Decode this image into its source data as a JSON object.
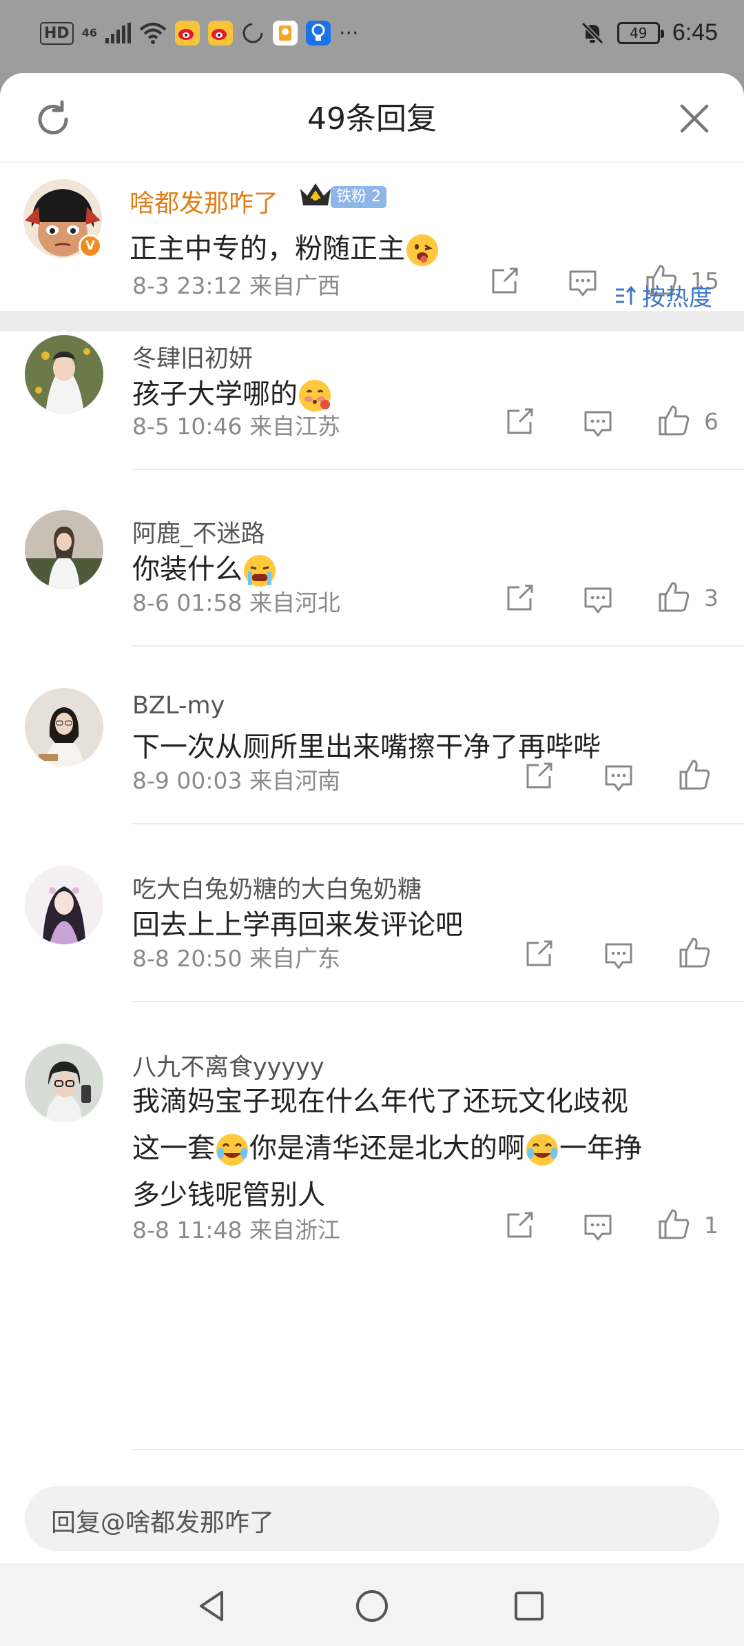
{
  "status_bar": {
    "hd": "HD",
    "signal": "46",
    "battery": "49",
    "time": "6:45",
    "more": "···"
  },
  "header": {
    "title": "49条回复"
  },
  "main_comment": {
    "name": "啥都发那咋了",
    "fan_badge": "铁粉 2",
    "text": "正主中专的，粉随正主",
    "meta": "8-3 23:12  来自广西",
    "likes": "15"
  },
  "sort": {
    "label": "按热度"
  },
  "replies": [
    {
      "name": "冬肆旧初妍",
      "lines": [
        "孩子大学哪的"
      ],
      "meta": "8-5 10:46  来自江苏",
      "likes": "6"
    },
    {
      "name": "阿鹿_不迷路",
      "lines": [
        "你装什么"
      ],
      "meta": "8-6 01:58  来自河北",
      "likes": "3"
    },
    {
      "name": "BZL-my",
      "lines": [
        "下一次从厕所里出来嘴擦干净了再哔哔"
      ],
      "meta": "8-9 00:03  来自河南",
      "likes": ""
    },
    {
      "name": "吃大白兔奶糖的大白兔奶糖",
      "lines": [
        "回去上上学再回来发评论吧"
      ],
      "meta": "8-8 20:50  来自广东",
      "likes": ""
    },
    {
      "name": "八九不离食yyyyy",
      "lines": [
        "我滴妈宝子现在什么年代了还玩文化歧视",
        "这一套",
        "你是清华还是北大的啊",
        "一年挣",
        "多少钱呢管别人"
      ],
      "meta": "8-8 11:48  来自浙江",
      "likes": "1"
    }
  ],
  "input": {
    "placeholder": "回复@啥都发那咋了"
  },
  "colors": {
    "accent_blue": "#3d78c8",
    "name_orange": "#e07d17",
    "meta_gray": "#8a8a8a"
  }
}
